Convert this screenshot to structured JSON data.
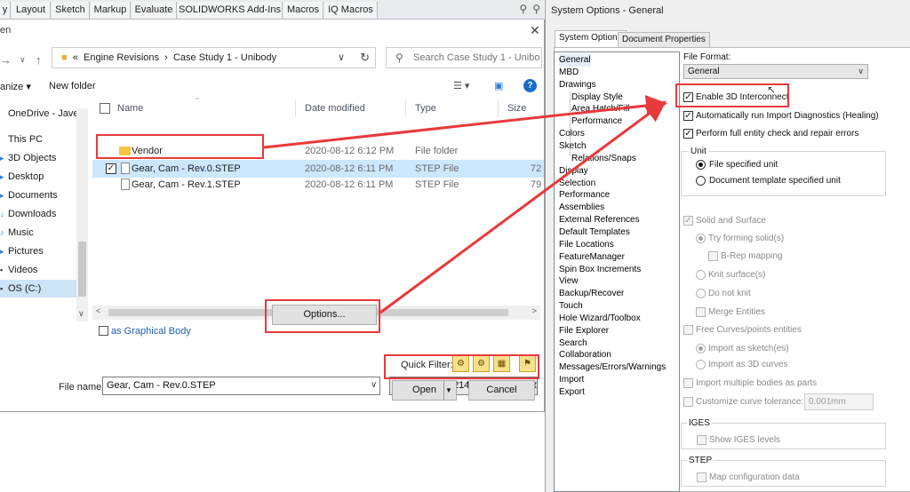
{
  "ribbon": {
    "tabs": [
      "y",
      "Layout",
      "Sketch",
      "Markup",
      "Evaluate",
      "SOLIDWORKS Add-Ins",
      "Macros",
      "IQ Macros"
    ]
  },
  "open_dialog": {
    "title": "en",
    "breadcrumb": [
      "«",
      "Engine Revisions",
      "›",
      "Case Study 1 - Unibody"
    ],
    "search_placeholder": "Search Case Study 1 - Unibo...",
    "organize": "anize ▾",
    "new_folder": "New folder",
    "help": "?",
    "nav": [
      "OneDrive - Javelin",
      "This PC",
      "3D Objects",
      "Desktop",
      "Documents",
      "Downloads",
      "Music",
      "Pictures",
      "Videos",
      "OS (C:)"
    ],
    "columns": {
      "name": "Name",
      "date": "Date modified",
      "type": "Type",
      "size": "Size"
    },
    "files": [
      {
        "name": "Vendor",
        "date": "2020-08-12 6:12 PM",
        "type": "File folder",
        "size": ""
      },
      {
        "name": "Gear, Cam - Rev.0.STEP",
        "date": "2020-08-12 6:11 PM",
        "type": "STEP File",
        "size": "72"
      },
      {
        "name": "Gear, Cam - Rev.1.STEP",
        "date": "2020-08-12 6:11 PM",
        "type": "STEP File",
        "size": "79"
      }
    ],
    "graphical_body": "as Graphical Body",
    "options_button": "Options...",
    "quick_filter": "Quick Filter:",
    "file_name_label": "File name:",
    "file_name_value": "Gear, Cam - Rev.0.STEP",
    "file_type": "STEP AP203/214/242 (*.step;*.st",
    "open_button": "Open",
    "cancel_button": "Cancel"
  },
  "system_options": {
    "title": "System Options - General",
    "tabs": [
      "System Options",
      "Document Properties"
    ],
    "tree": [
      "General",
      "MBD",
      "Drawings",
      "Display Style",
      "Area Hatch/Fill",
      "Performance",
      "Colors",
      "Sketch",
      "Relations/Snaps",
      "Display",
      "Selection",
      "Performance",
      "Assemblies",
      "External References",
      "Default Templates",
      "File Locations",
      "FeatureManager",
      "Spin Box Increments",
      "View",
      "Backup/Recover",
      "Touch",
      "Hole Wizard/Toolbox",
      "File Explorer",
      "Search",
      "Collaboration",
      "Messages/Errors/Warnings",
      "Import",
      "Export"
    ],
    "file_format_label": "File Format:",
    "file_format_value": "General",
    "enable_3d_interconnect": "Enable 3D Interconnect",
    "auto_import_diag": "Automatically run Import Diagnostics (Healing)",
    "full_entity_check": "Perform full entity check and repair errors",
    "unit_group": "Unit",
    "unit_file_specified": "File specified unit",
    "unit_document_template": "Document template specified unit",
    "solid_and_surface": "Solid and Surface",
    "try_forming_solids": "Try forming solid(s)",
    "brep_mapping": "B-Rep mapping",
    "knit_surfaces": "Knit surface(s)",
    "do_not_knit": "Do not knit",
    "merge_entities": "Merge Entities",
    "free_curves": "Free Curves/points entities",
    "import_as_sketch": "Import as sketch(es)",
    "import_as_3d_curves": "Import as 3D curves",
    "import_multiple_bodies": "Import multiple bodies as parts",
    "customize_curve_tol": "Customize curve tolerance:",
    "tolerance_value": "0.001mm",
    "iges_group": "IGES",
    "show_iges_levels": "Show IGES levels",
    "step_group": "STEP",
    "map_configuration_data": "Map configuration data"
  }
}
